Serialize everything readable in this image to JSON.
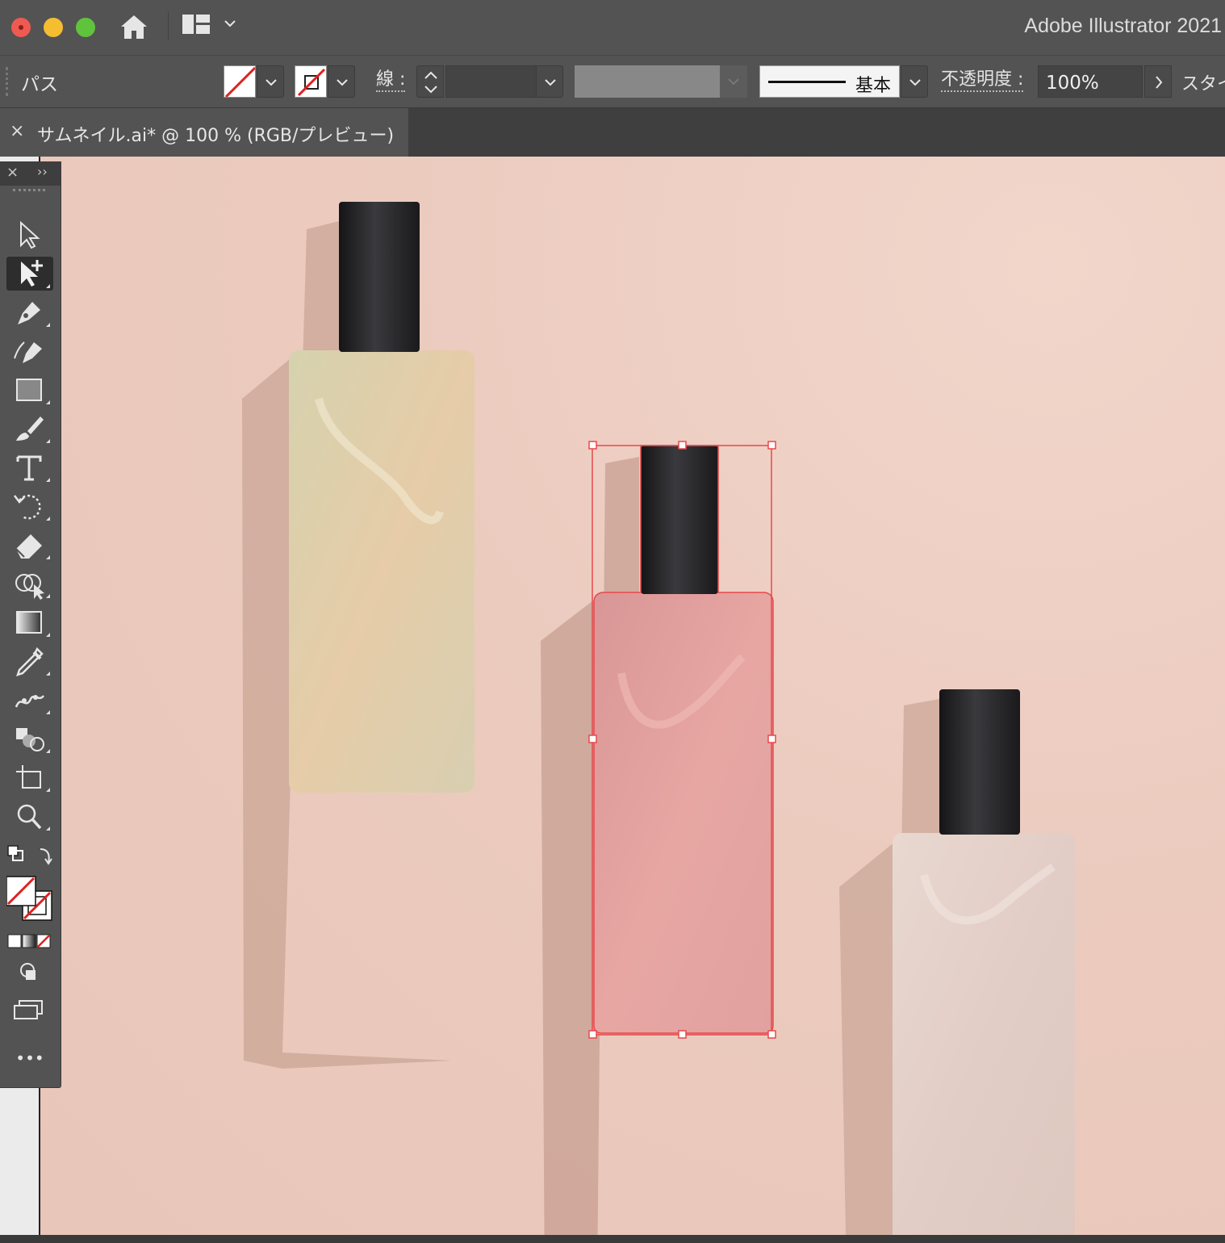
{
  "app": {
    "title": "Adobe Illustrator 2021"
  },
  "control_bar": {
    "selection_label": "パス",
    "stroke_label": "線 :",
    "brush_name": "基本",
    "opacity_label": "不透明度 :",
    "opacity_value": "100%",
    "style_label": "スタイル"
  },
  "document_tab": {
    "close_glyph": "×",
    "title": "サムネイル.ai* @ 100 % (RGB/プレビュー)"
  },
  "toolbar": {
    "close_glyph": "×",
    "expand_glyph": "››",
    "more_glyph": "•••"
  },
  "colors": {
    "bg_pink": "#ecccc0",
    "selection": "#e8484c",
    "bottle_green": "#dcd0b4",
    "bottle_pink": "#e4a3a1",
    "bottle_white": "#e4d2cb",
    "cap": "#1f1f21"
  },
  "icons": [
    "home-icon",
    "workspace-icon",
    "selection-tool-icon",
    "direct-selection-tool-icon",
    "pen-tool-icon",
    "curvature-tool-icon",
    "rectangle-tool-icon",
    "paintbrush-tool-icon",
    "type-tool-icon",
    "rotate-tool-icon",
    "eraser-tool-icon",
    "shape-builder-tool-icon",
    "gradient-tool-icon",
    "eyedropper-tool-icon",
    "puppet-warp-tool-icon",
    "blend-tool-icon",
    "artboard-tool-icon",
    "zoom-tool-icon",
    "fill-stroke-icon",
    "draw-mode-icon",
    "screen-mode-icon"
  ]
}
